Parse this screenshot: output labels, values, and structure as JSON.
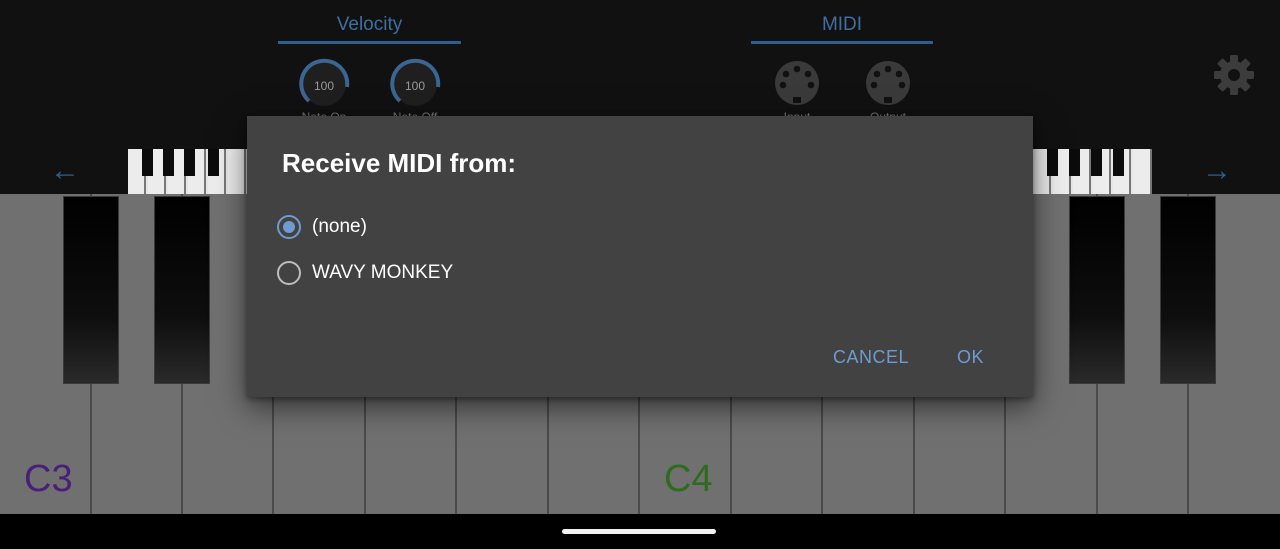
{
  "controls": {
    "velocity": {
      "title": "Velocity",
      "knobs": [
        {
          "value": "100",
          "caption": "Note On"
        },
        {
          "value": "100",
          "caption": "Note Off"
        }
      ]
    },
    "midi": {
      "title": "MIDI",
      "ports": [
        {
          "caption": "Input"
        },
        {
          "caption": "Output"
        }
      ]
    }
  },
  "navigation": {
    "left_arrow": "←",
    "right_arrow": "→"
  },
  "keyboard": {
    "labels": [
      {
        "text": "C3",
        "color": "#4a1f78"
      },
      {
        "text": "C4",
        "color": "#2f6b1f"
      }
    ]
  },
  "dialog": {
    "title": "Receive MIDI from:",
    "options": [
      {
        "label": "(none)",
        "selected": true
      },
      {
        "label": "WAVY MONKEY",
        "selected": false
      }
    ],
    "cancel_label": "CANCEL",
    "ok_label": "OK"
  },
  "colors": {
    "accent": "#6f9bd1",
    "header_accent": "#2f5f8f",
    "dialog_bg": "#424242",
    "white_key": "#707070"
  }
}
